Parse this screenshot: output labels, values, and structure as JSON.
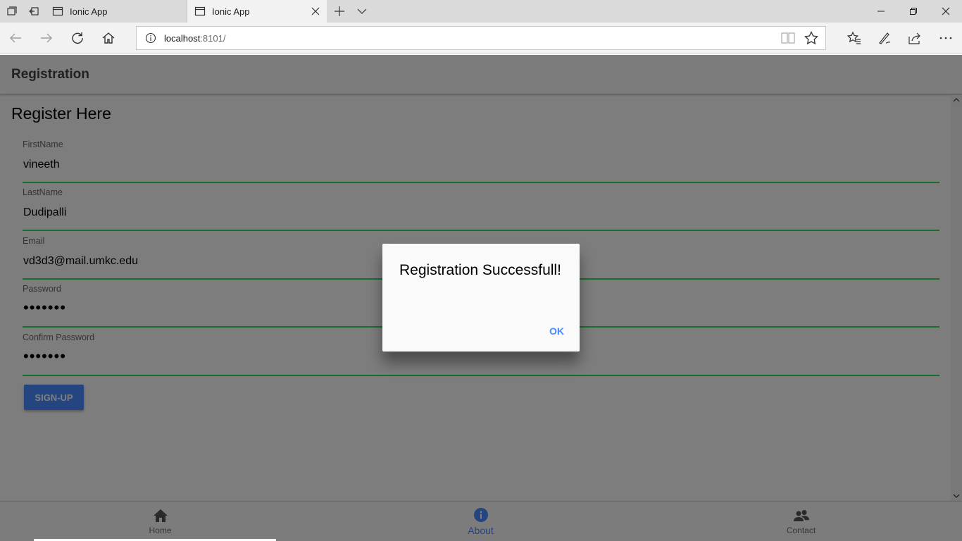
{
  "browser": {
    "tabs": [
      {
        "title": "Ionic App"
      },
      {
        "title": "Ionic App"
      }
    ],
    "url_host": "localhost",
    "url_port": ":8101/"
  },
  "app": {
    "header_title": "Registration",
    "heading": "Register Here",
    "fields": [
      {
        "label": "FirstName",
        "value": "vineeth"
      },
      {
        "label": "LastName",
        "value": "Dudipalli"
      },
      {
        "label": "Email",
        "value": "vd3d3@mail.umkc.edu"
      },
      {
        "label": "Password",
        "value": "•••••••"
      },
      {
        "label": "Confirm Password",
        "value": "•••••••"
      }
    ],
    "signup_label": "SIGN-UP",
    "tabbar": [
      {
        "label": "Home",
        "icon": "home-icon"
      },
      {
        "label": "About",
        "icon": "info-icon"
      },
      {
        "label": "Contact",
        "icon": "contacts-icon"
      }
    ],
    "active_tab": "About"
  },
  "alert": {
    "title": "Registration Successfull!",
    "ok_label": "OK"
  },
  "colors": {
    "accent": "#488aff",
    "input_underline": "#32db64"
  }
}
